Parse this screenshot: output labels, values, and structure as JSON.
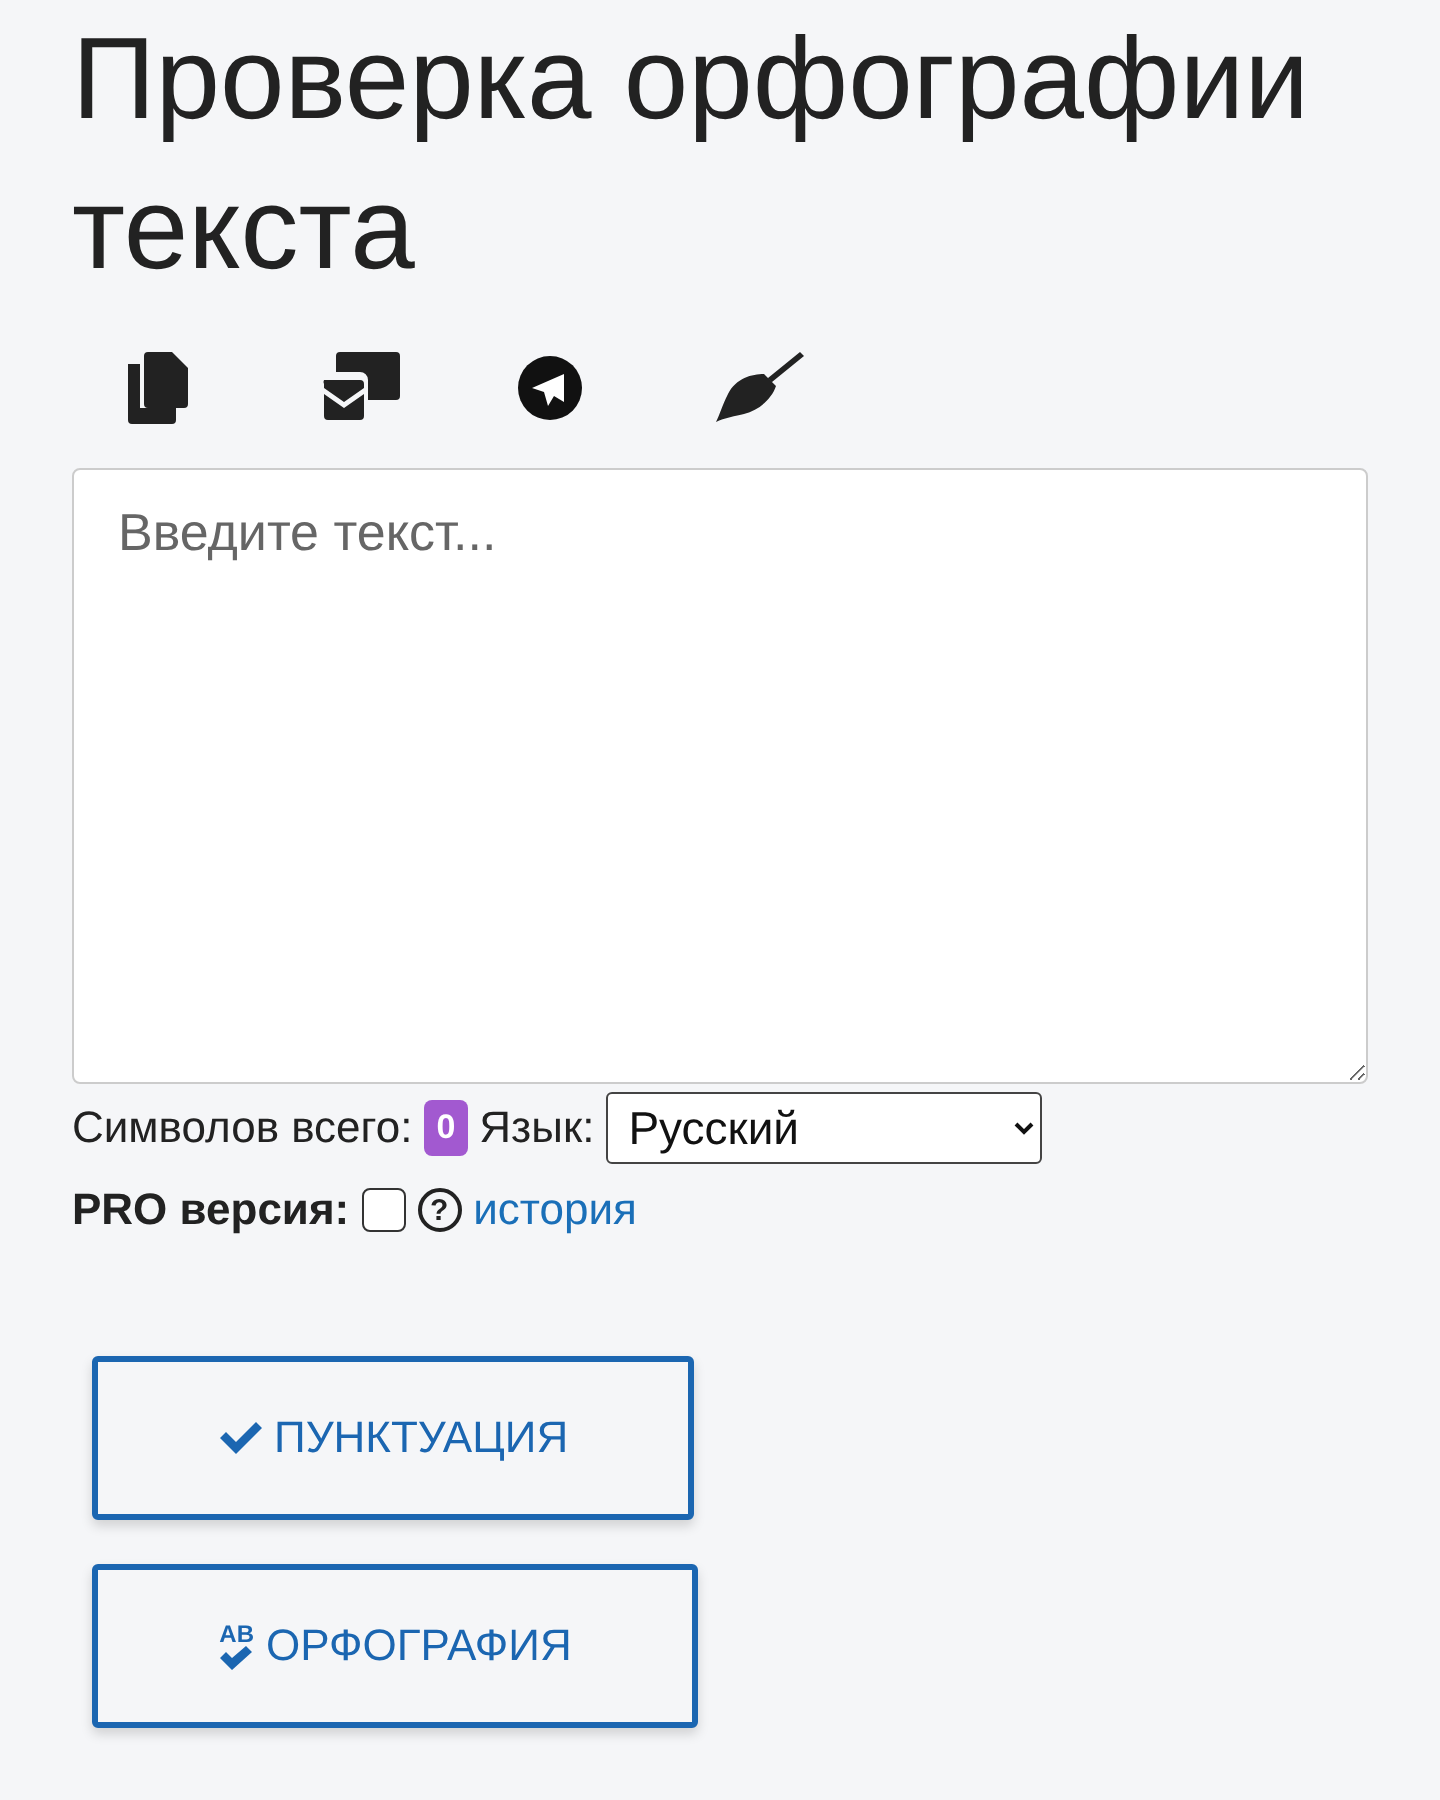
{
  "title": "Проверка орфографии текста",
  "toolbar": [
    {
      "kind": "copy"
    },
    {
      "kind": "share"
    },
    {
      "kind": "telegram"
    },
    {
      "kind": "clear"
    }
  ],
  "editor": {
    "placeholder": "Введите текст..."
  },
  "stats": {
    "label": "Символов всего:",
    "count": "0",
    "language_label": "Язык:",
    "language": "Русский"
  },
  "pro": {
    "label": "PRO версия:",
    "checked": false,
    "help": "?",
    "link": "история"
  },
  "buttons": [
    {
      "kind": "punctuation",
      "label": "ПУНКТУАЦИЯ"
    },
    {
      "kind": "spelling",
      "label": "ОРФОГРАФИЯ",
      "icon_text": "AB"
    }
  ]
}
